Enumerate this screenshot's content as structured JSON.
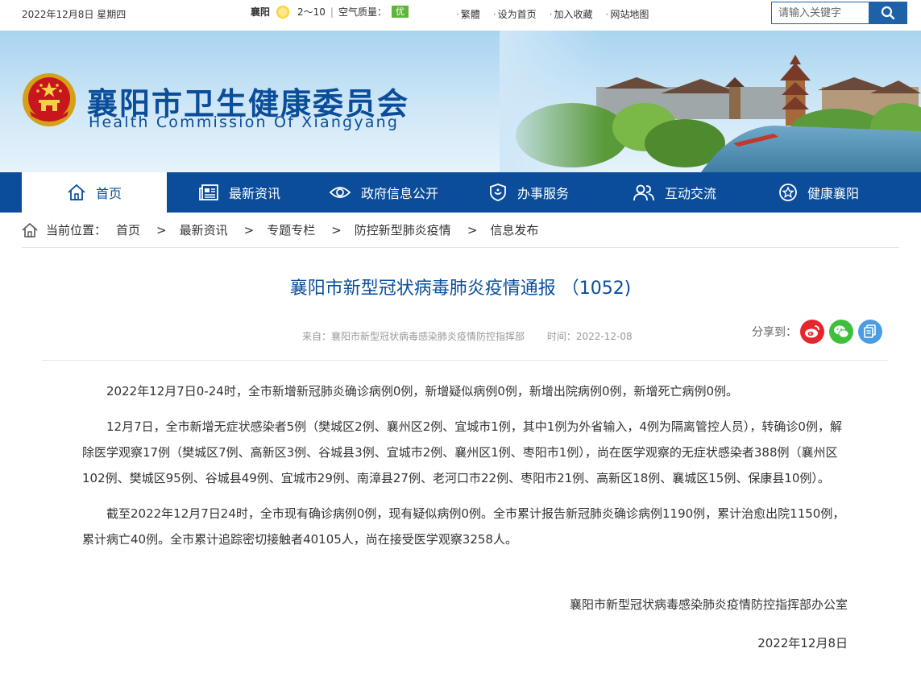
{
  "topbar": {
    "date": "2022年12月8日 星期四",
    "city": "襄阳",
    "temp": "2～10",
    "aqi_label": "空气质量：",
    "aqi_value": "优",
    "links": [
      "繁體",
      "设为首页",
      "加入收藏",
      "网站地图"
    ],
    "search_placeholder": "请输入关键字"
  },
  "header": {
    "title": "襄阳市卫生健康委员会",
    "subtitle": "Health Commission Of Xiangyang"
  },
  "nav": {
    "items": [
      "首页",
      "最新资讯",
      "政府信息公开",
      "办事服务",
      "互动交流",
      "健康襄阳"
    ]
  },
  "breadcrumb": {
    "label": "当前位置：",
    "items": [
      "首页",
      "最新资讯",
      "专题专栏",
      "防控新型肺炎疫情",
      "信息发布"
    ],
    "separator": ">"
  },
  "article": {
    "title": "襄阳市新型冠状病毒肺炎疫情通报 （1052)",
    "source": "来自：襄阳市新型冠状病毒感染肺炎疫情防控指挥部",
    "time": "时间：2022-12-08",
    "share_label": "分享到：",
    "paragraphs": [
      "2022年12月7日0-24时，全市新增新冠肺炎确诊病例0例，新增疑似病例0例，新增出院病例0例，新增死亡病例0例。",
      "12月7日，全市新增无症状感染者5例（樊城区2例、襄州区2例、宜城市1例，其中1例为外省输入，4例为隔离管控人员），转确诊0例，解除医学观察17例（樊城区7例、高新区3例、谷城县3例、宜城市2例、襄州区1例、枣阳市1例），尚在医学观察的无症状感染者388例（襄州区102例、樊城区95例、谷城县49例、宜城市29例、南漳县27例、老河口市22例、枣阳市21例、高新区18例、襄城区15例、保康县10例）。",
      "截至2022年12月7日24时，全市现有确诊病例0例，现有疑似病例0例。全市累计报告新冠肺炎确诊病例1190例，累计治愈出院1150例，累计病亡40例。全市累计追踪密切接触者40105人，尚在接受医学观察3258人。"
    ],
    "signature": "襄阳市新型冠状病毒感染肺炎疫情防控指挥部办公室",
    "sign_date": "2022年12月8日"
  },
  "colors": {
    "primary": "#0b4d9a",
    "aqi": "#5fb53b",
    "weibo": "#e6262d",
    "wechat": "#3fbf3c",
    "copy": "#4a9de3"
  }
}
